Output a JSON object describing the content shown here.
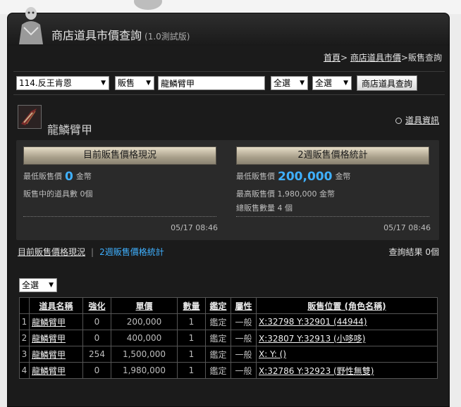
{
  "header": {
    "title": "商店道具市價查詢",
    "version": "(1.0測試版)"
  },
  "breadcrumb": {
    "home": "首頁",
    "sep1": ">",
    "market": "商店道具市價",
    "sep2": ">",
    "current": "販售查詢"
  },
  "search": {
    "server": "114.反王肯恩",
    "trade_type": "販售",
    "keyword": "龍鱗臂甲",
    "filter1": "全選",
    "filter2": "全選",
    "query_button": "商店道具查詢"
  },
  "item": {
    "name": "龍鱗臂甲",
    "info_link": "道具資訊"
  },
  "current_price": {
    "header": "目前販售價格現況",
    "min_label": "最低販售價",
    "min_value": "0",
    "currency": "金幣",
    "count_label": "販售中的道具數 0個",
    "timestamp": "05/17 08:46"
  },
  "weekly_stats": {
    "header": "2週販售價格統計",
    "min_label": "最低販售價",
    "min_value": "200,000",
    "currency": "金幣",
    "max_label": "最高販售價 1,980,000 金幣",
    "total_label": "總販售數量 4 個",
    "timestamp": "05/17 08:46"
  },
  "tabs": {
    "current": "目前販售價格現況",
    "separator": "|",
    "weekly": "2週販售價格統計"
  },
  "result_count": "查詢結果 0個",
  "list_filter": "全選",
  "table": {
    "headers": [
      "道具名稱",
      "強化",
      "單價",
      "數量",
      "鑑定",
      "屬性",
      "販售位置 (角色名稱)"
    ],
    "rows": [
      {
        "idx": "1",
        "name": "龍鱗臂甲",
        "enhance": "0",
        "price": "200,000",
        "qty": "1",
        "identified": "鑑定",
        "attr": "一般",
        "location": "X:32798 Y:32901 (44944)"
      },
      {
        "idx": "2",
        "name": "龍鱗臂甲",
        "enhance": "0",
        "price": "400,000",
        "qty": "1",
        "identified": "鑑定",
        "attr": "一般",
        "location": "X:32807 Y:32913 (小哆哆)"
      },
      {
        "idx": "3",
        "name": "龍鱗臂甲",
        "enhance": "254",
        "price": "1,500,000",
        "qty": "1",
        "identified": "鑑定",
        "attr": "一般",
        "location": "X: Y: ()"
      },
      {
        "idx": "4",
        "name": "龍鱗臂甲",
        "enhance": "0",
        "price": "1,980,000",
        "qty": "1",
        "identified": "鑑定",
        "attr": "一般",
        "location": "X:32786 Y:32923 (野性無雙)"
      }
    ]
  },
  "icons": {
    "avatar": "character-avatar-icon",
    "item": "dragon-scale-armguard-icon",
    "info": "circle-icon",
    "dropdown": "chevron-down-icon"
  },
  "colors": {
    "accent_blue": "#3fb0ff",
    "panel_bg": "#1b1b1b",
    "box_bg": "#2a2a2a"
  }
}
